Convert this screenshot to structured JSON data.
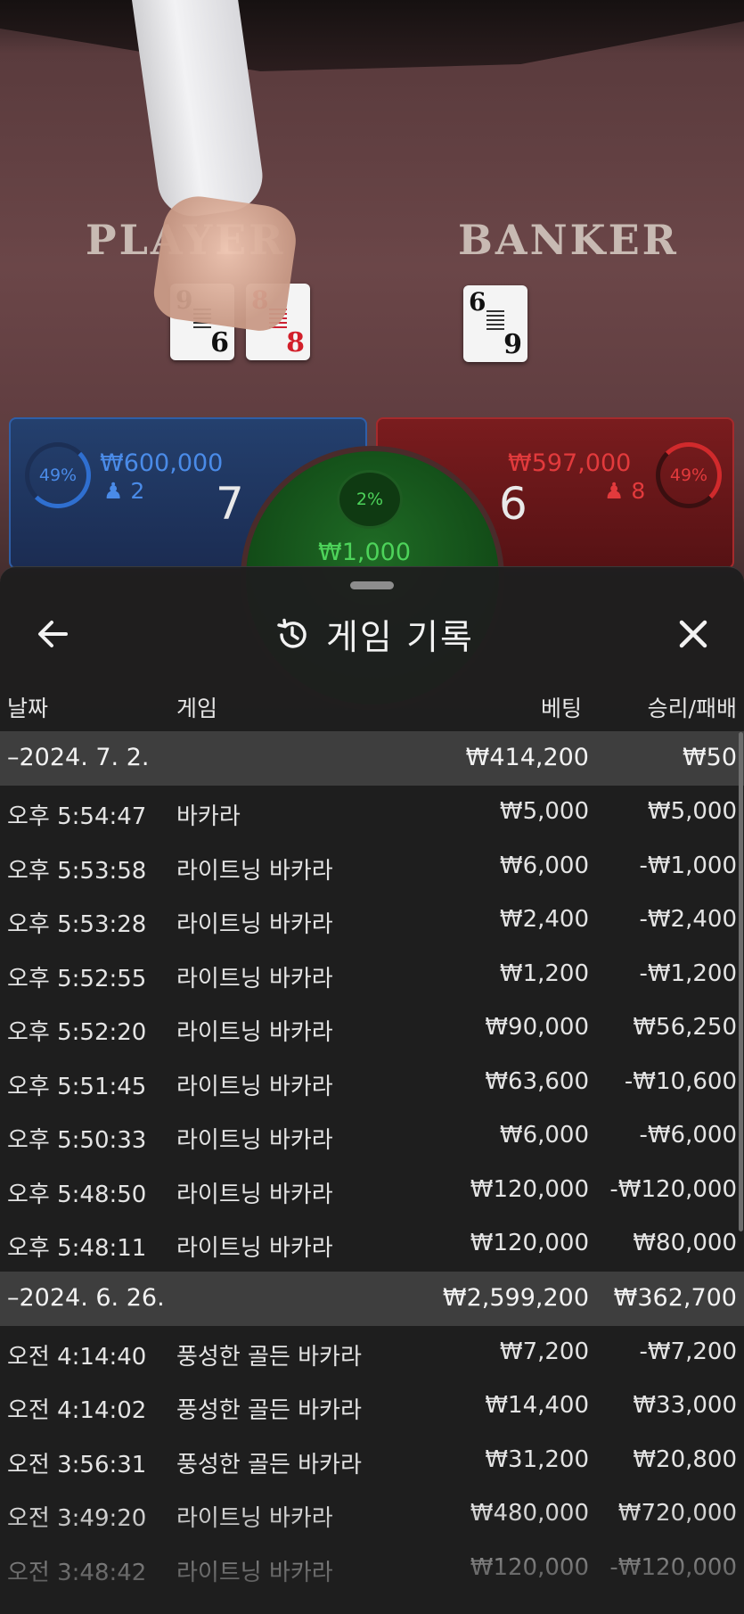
{
  "table": {
    "player_title": "PLAYER",
    "banker_title": "BANKER",
    "player": {
      "percent": "49%",
      "amount": "₩600,000",
      "count": "2",
      "score": "7"
    },
    "banker": {
      "percent": "49%",
      "amount": "₩597,000",
      "count": "8",
      "score": "6"
    },
    "tie": {
      "percent": "2%",
      "amount": "₩1,000"
    },
    "colors": {
      "player": "#2f6fd0",
      "banker": "#d12a2c",
      "tie": "#4dd35a"
    }
  },
  "sheet": {
    "title": "게임 기록",
    "title_icon": "history-icon",
    "back_icon": "arrow-left-icon",
    "close_icon": "close-icon",
    "columns": {
      "date": "날짜",
      "game": "게임",
      "bet": "베팅",
      "result": "승리/패배"
    },
    "groups": [
      {
        "date": "–2024. 7. 2.",
        "bet_total": "₩414,200",
        "result_total": "₩50",
        "rows": [
          {
            "time": "오후 5:54:47",
            "game": "바카라",
            "bet": "₩5,000",
            "result": "₩5,000"
          },
          {
            "time": "오후 5:53:58",
            "game": "라이트닝 바카라",
            "bet": "₩6,000",
            "result": "-₩1,000"
          },
          {
            "time": "오후 5:53:28",
            "game": "라이트닝 바카라",
            "bet": "₩2,400",
            "result": "-₩2,400"
          },
          {
            "time": "오후 5:52:55",
            "game": "라이트닝 바카라",
            "bet": "₩1,200",
            "result": "-₩1,200"
          },
          {
            "time": "오후 5:52:20",
            "game": "라이트닝 바카라",
            "bet": "₩90,000",
            "result": "₩56,250"
          },
          {
            "time": "오후 5:51:45",
            "game": "라이트닝 바카라",
            "bet": "₩63,600",
            "result": "-₩10,600"
          },
          {
            "time": "오후 5:50:33",
            "game": "라이트닝 바카라",
            "bet": "₩6,000",
            "result": "-₩6,000"
          },
          {
            "time": "오후 5:48:50",
            "game": "라이트닝 바카라",
            "bet": "₩120,000",
            "result": "-₩120,000"
          },
          {
            "time": "오후 5:48:11",
            "game": "라이트닝 바카라",
            "bet": "₩120,000",
            "result": "₩80,000"
          }
        ]
      },
      {
        "date": "–2024. 6. 26.",
        "bet_total": "₩2,599,200",
        "result_total": "₩362,700",
        "rows": [
          {
            "time": "오전 4:14:40",
            "game": "풍성한 골든 바카라",
            "bet": "₩7,200",
            "result": "-₩7,200"
          },
          {
            "time": "오전 4:14:02",
            "game": "풍성한 골든 바카라",
            "bet": "₩14,400",
            "result": "₩33,000"
          },
          {
            "time": "오전 3:56:31",
            "game": "풍성한 골든 바카라",
            "bet": "₩31,200",
            "result": "₩20,800"
          },
          {
            "time": "오전 3:49:20",
            "game": "라이트닝 바카라",
            "bet": "₩480,000",
            "result": "₩720,000"
          },
          {
            "time": "오전 3:48:42",
            "game": "라이트닝 바카라",
            "bet": "₩120,000",
            "result": "-₩120,000"
          }
        ]
      }
    ]
  }
}
